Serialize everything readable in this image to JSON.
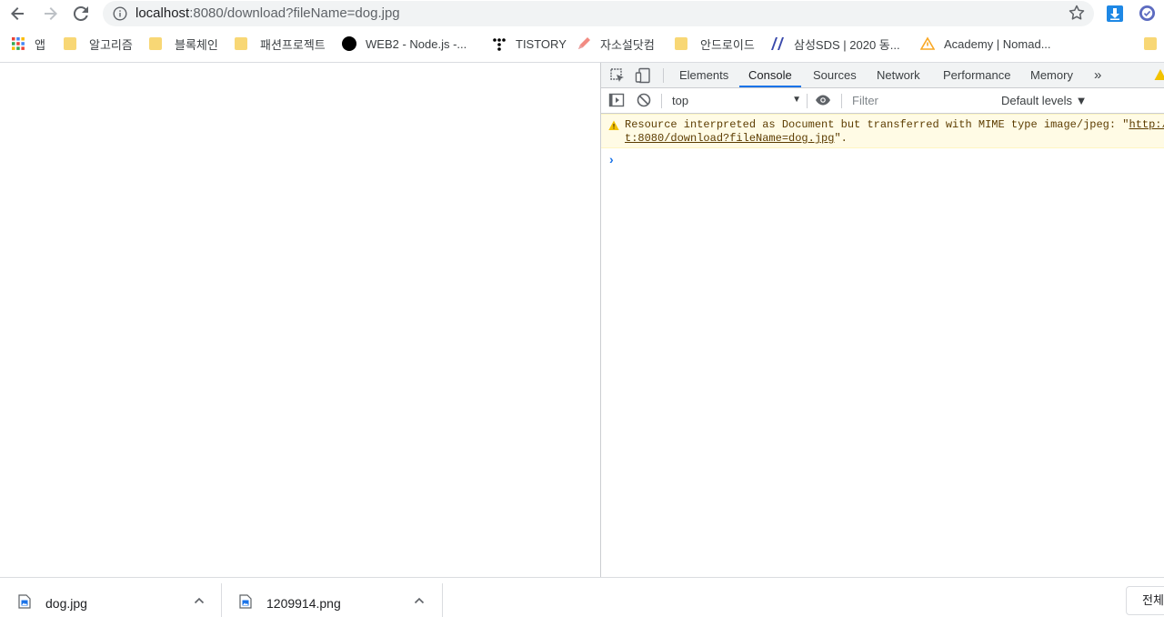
{
  "browser": {
    "omnibox": {
      "host": "localhost",
      "path": ":8080/download?fileName=dog.jpg"
    },
    "bookmarks": [
      {
        "label": "앱",
        "icon": "apps-grid-icon"
      },
      {
        "label": "알고리즘",
        "icon": "folder-icon"
      },
      {
        "label": "블록체인",
        "icon": "folder-icon"
      },
      {
        "label": "패션프로젝트",
        "icon": "folder-icon"
      },
      {
        "label": "WEB2 - Node.js -...",
        "icon": "black-circle-icon"
      },
      {
        "label": "TISTORY",
        "icon": "tistory-icon"
      },
      {
        "label": "자소설닷컴",
        "icon": "pencil-icon"
      },
      {
        "label": "안드로이드",
        "icon": "folder-icon"
      },
      {
        "label": "삼성SDS | 2020 동...",
        "icon": "slash-logo-icon"
      },
      {
        "label": "Academy | Nomad...",
        "icon": "nomad-logo-icon"
      }
    ]
  },
  "devtools": {
    "tabs": [
      "Elements",
      "Console",
      "Sources",
      "Network",
      "Performance",
      "Memory"
    ],
    "active_tab": "Console",
    "more_tabs": "»",
    "context": "top",
    "filter_placeholder": "Filter",
    "levels": "Default levels ▼",
    "messages": [
      {
        "level": "warning",
        "line1_prefix": "Resource interpreted as Document but transferred with MIME type image/jpeg: \"",
        "line1_link": "http://",
        "line2_link": "t:8080/download?fileName=dog.jpg",
        "line2_suffix": "\"."
      }
    ],
    "prompt": "›"
  },
  "downloads": {
    "items": [
      {
        "name": "dog.jpg"
      },
      {
        "name": "1209914.png"
      }
    ],
    "show_all": "전체"
  },
  "colors": {
    "accent": "#1a73e8",
    "warning_bg": "#fffbe5",
    "warning_text": "#5c3c00",
    "folder": "#f8d775"
  }
}
